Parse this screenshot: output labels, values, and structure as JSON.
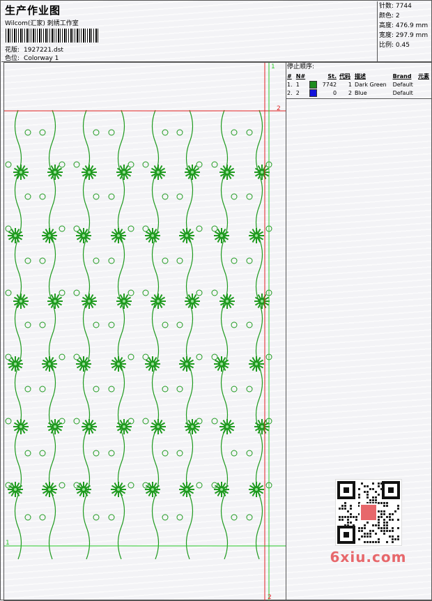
{
  "header": {
    "title": "生产作业图",
    "studio": "Wilcom(汇家) 刺绣工作室",
    "design_label": "花版:",
    "design_file": "1927221.dst",
    "colorway_label": "色位:",
    "colorway": "Colorway 1"
  },
  "stats": {
    "stitches_label": "针数:",
    "stitches": "7744",
    "colors_label": "颜色:",
    "colors": "2",
    "height_label": "高度:",
    "height": "476.9 mm",
    "width_label": "宽度:",
    "width": "297.9 mm",
    "scale_label": "比例:",
    "scale": "0.45"
  },
  "panel": {
    "stop_sequence_label": "停止顺序:",
    "columns": [
      "#",
      "N#",
      "St.",
      "代码",
      "描述",
      "Brand",
      "元素"
    ],
    "rows": [
      {
        "idx": "1.",
        "n": "1",
        "color": "#1e8c1e",
        "st": "7742",
        "code": "1",
        "desc": "Dark Green",
        "brand": "Default"
      },
      {
        "idx": "2.",
        "n": "2",
        "color": "#1414dc",
        "st": "0",
        "code": "2",
        "desc": "Blue",
        "brand": "Default"
      }
    ]
  },
  "guides": {
    "green_label_top": "1",
    "red_label_top": "2",
    "green_label_left": "1",
    "red_label_bottom": "2"
  },
  "watermark": {
    "text": "6xiu.com"
  },
  "colors": {
    "stitch_green": "#1e9a1e",
    "guide_red": "#e02020",
    "guide_green": "#28c828"
  }
}
